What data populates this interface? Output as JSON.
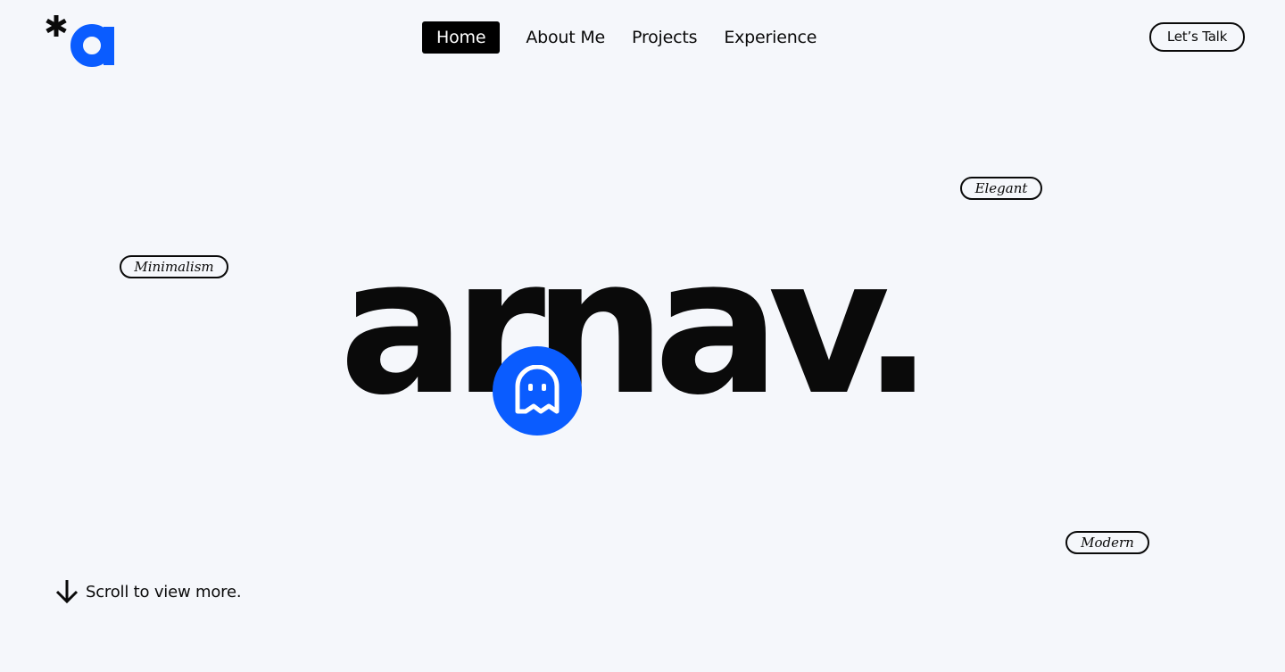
{
  "brand": {
    "logo_letter": "a",
    "logo_mark": "*",
    "accent_color": "#0a5cff"
  },
  "nav": {
    "items": [
      {
        "label": "Home",
        "active": true
      },
      {
        "label": "About Me",
        "active": false
      },
      {
        "label": "Projects",
        "active": false
      },
      {
        "label": "Experience",
        "active": false
      }
    ],
    "cta_label": "Let’s Talk"
  },
  "hero": {
    "word": "arnav.",
    "badge_icon": "ghost-icon"
  },
  "tags": {
    "elegant": "Elegant",
    "minimalism": "Minimalism",
    "modern": "Modern"
  },
  "scroll": {
    "icon": "arrow-down-icon",
    "label": "Scroll to view more."
  }
}
